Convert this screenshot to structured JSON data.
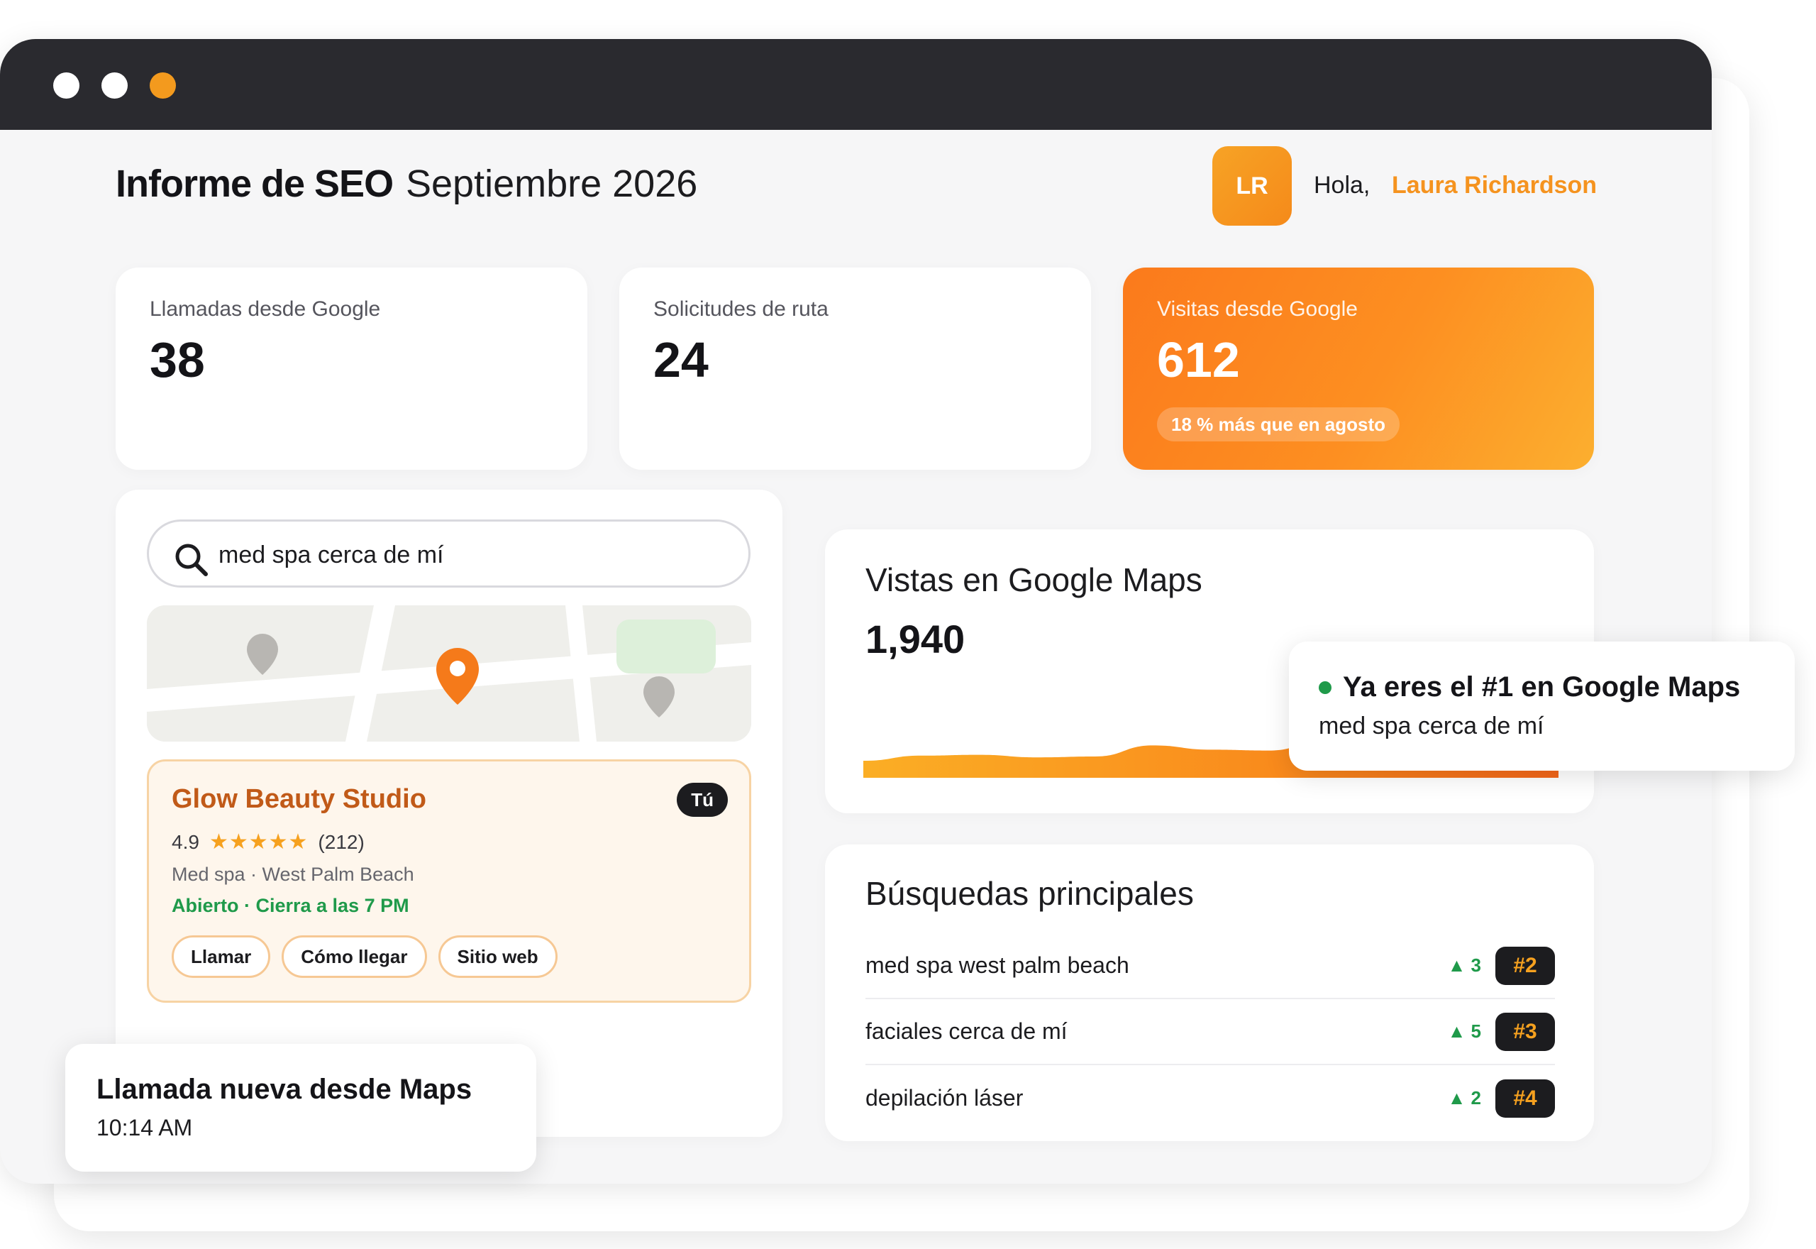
{
  "window": {
    "accent_color": "#f5931f"
  },
  "header": {
    "title": "Informe de SEO",
    "date": "Septiembre 2026",
    "avatar_initials": "LR",
    "greeting": "Hola,",
    "user_name": "Laura Richardson"
  },
  "stats": [
    {
      "label": "Llamadas desde Google",
      "value": "38"
    },
    {
      "label": "Solicitudes de ruta",
      "value": "24"
    },
    {
      "label": "Visitas desde Google",
      "value": "612",
      "badge": "18 % más que en agosto"
    }
  ],
  "map_search": {
    "query": "med spa cerca de mí",
    "listing": {
      "name": "Glow Beauty Studio",
      "badge": "Tú",
      "rating": "4.9",
      "stars": "★★★★★",
      "reviews": "(212)",
      "meta": "Med spa · West Palm Beach",
      "status": "Abierto · Cierra a las 7 PM",
      "actions": [
        "Llamar",
        "Cómo llegar",
        "Sitio web"
      ]
    }
  },
  "maps_views": {
    "title": "Vistas en Google Maps",
    "value": "1,940"
  },
  "chart_data": {
    "type": "area",
    "title": "Vistas en Google Maps",
    "x": [
      0,
      1,
      2,
      3,
      4,
      5,
      6,
      7,
      8,
      9,
      10,
      11,
      12
    ],
    "values": [
      20,
      26,
      27,
      24,
      25,
      38,
      33,
      32,
      44,
      60,
      55,
      52,
      58
    ]
  },
  "top_searches": {
    "title": "Búsquedas principales",
    "rows": [
      {
        "query": "med spa west palm beach",
        "change": "▲ 3",
        "rank": "#2"
      },
      {
        "query": "faciales cerca de mí",
        "change": "▲ 5",
        "rank": "#3"
      },
      {
        "query": "depilación láser",
        "change": "▲ 2",
        "rank": "#4"
      }
    ]
  },
  "toasts": {
    "call": {
      "title": "Llamada nueva desde Maps",
      "time": "10:14 AM"
    },
    "rank": {
      "title": "Ya eres el #1 en Google Maps",
      "subtitle": "med spa cerca de mí"
    }
  }
}
